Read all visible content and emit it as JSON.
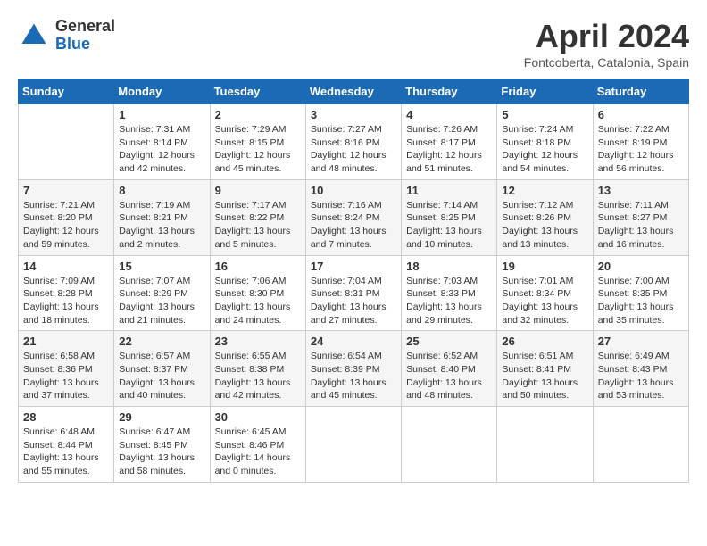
{
  "header": {
    "logo_general": "General",
    "logo_blue": "Blue",
    "month_year": "April 2024",
    "location": "Fontcoberta, Catalonia, Spain"
  },
  "weekdays": [
    "Sunday",
    "Monday",
    "Tuesday",
    "Wednesday",
    "Thursday",
    "Friday",
    "Saturday"
  ],
  "weeks": [
    [
      {
        "day": "",
        "sunrise": "",
        "sunset": "",
        "daylight": ""
      },
      {
        "day": "1",
        "sunrise": "Sunrise: 7:31 AM",
        "sunset": "Sunset: 8:14 PM",
        "daylight": "Daylight: 12 hours and 42 minutes."
      },
      {
        "day": "2",
        "sunrise": "Sunrise: 7:29 AM",
        "sunset": "Sunset: 8:15 PM",
        "daylight": "Daylight: 12 hours and 45 minutes."
      },
      {
        "day": "3",
        "sunrise": "Sunrise: 7:27 AM",
        "sunset": "Sunset: 8:16 PM",
        "daylight": "Daylight: 12 hours and 48 minutes."
      },
      {
        "day": "4",
        "sunrise": "Sunrise: 7:26 AM",
        "sunset": "Sunset: 8:17 PM",
        "daylight": "Daylight: 12 hours and 51 minutes."
      },
      {
        "day": "5",
        "sunrise": "Sunrise: 7:24 AM",
        "sunset": "Sunset: 8:18 PM",
        "daylight": "Daylight: 12 hours and 54 minutes."
      },
      {
        "day": "6",
        "sunrise": "Sunrise: 7:22 AM",
        "sunset": "Sunset: 8:19 PM",
        "daylight": "Daylight: 12 hours and 56 minutes."
      }
    ],
    [
      {
        "day": "7",
        "sunrise": "Sunrise: 7:21 AM",
        "sunset": "Sunset: 8:20 PM",
        "daylight": "Daylight: 12 hours and 59 minutes."
      },
      {
        "day": "8",
        "sunrise": "Sunrise: 7:19 AM",
        "sunset": "Sunset: 8:21 PM",
        "daylight": "Daylight: 13 hours and 2 minutes."
      },
      {
        "day": "9",
        "sunrise": "Sunrise: 7:17 AM",
        "sunset": "Sunset: 8:22 PM",
        "daylight": "Daylight: 13 hours and 5 minutes."
      },
      {
        "day": "10",
        "sunrise": "Sunrise: 7:16 AM",
        "sunset": "Sunset: 8:24 PM",
        "daylight": "Daylight: 13 hours and 7 minutes."
      },
      {
        "day": "11",
        "sunrise": "Sunrise: 7:14 AM",
        "sunset": "Sunset: 8:25 PM",
        "daylight": "Daylight: 13 hours and 10 minutes."
      },
      {
        "day": "12",
        "sunrise": "Sunrise: 7:12 AM",
        "sunset": "Sunset: 8:26 PM",
        "daylight": "Daylight: 13 hours and 13 minutes."
      },
      {
        "day": "13",
        "sunrise": "Sunrise: 7:11 AM",
        "sunset": "Sunset: 8:27 PM",
        "daylight": "Daylight: 13 hours and 16 minutes."
      }
    ],
    [
      {
        "day": "14",
        "sunrise": "Sunrise: 7:09 AM",
        "sunset": "Sunset: 8:28 PM",
        "daylight": "Daylight: 13 hours and 18 minutes."
      },
      {
        "day": "15",
        "sunrise": "Sunrise: 7:07 AM",
        "sunset": "Sunset: 8:29 PM",
        "daylight": "Daylight: 13 hours and 21 minutes."
      },
      {
        "day": "16",
        "sunrise": "Sunrise: 7:06 AM",
        "sunset": "Sunset: 8:30 PM",
        "daylight": "Daylight: 13 hours and 24 minutes."
      },
      {
        "day": "17",
        "sunrise": "Sunrise: 7:04 AM",
        "sunset": "Sunset: 8:31 PM",
        "daylight": "Daylight: 13 hours and 27 minutes."
      },
      {
        "day": "18",
        "sunrise": "Sunrise: 7:03 AM",
        "sunset": "Sunset: 8:33 PM",
        "daylight": "Daylight: 13 hours and 29 minutes."
      },
      {
        "day": "19",
        "sunrise": "Sunrise: 7:01 AM",
        "sunset": "Sunset: 8:34 PM",
        "daylight": "Daylight: 13 hours and 32 minutes."
      },
      {
        "day": "20",
        "sunrise": "Sunrise: 7:00 AM",
        "sunset": "Sunset: 8:35 PM",
        "daylight": "Daylight: 13 hours and 35 minutes."
      }
    ],
    [
      {
        "day": "21",
        "sunrise": "Sunrise: 6:58 AM",
        "sunset": "Sunset: 8:36 PM",
        "daylight": "Daylight: 13 hours and 37 minutes."
      },
      {
        "day": "22",
        "sunrise": "Sunrise: 6:57 AM",
        "sunset": "Sunset: 8:37 PM",
        "daylight": "Daylight: 13 hours and 40 minutes."
      },
      {
        "day": "23",
        "sunrise": "Sunrise: 6:55 AM",
        "sunset": "Sunset: 8:38 PM",
        "daylight": "Daylight: 13 hours and 42 minutes."
      },
      {
        "day": "24",
        "sunrise": "Sunrise: 6:54 AM",
        "sunset": "Sunset: 8:39 PM",
        "daylight": "Daylight: 13 hours and 45 minutes."
      },
      {
        "day": "25",
        "sunrise": "Sunrise: 6:52 AM",
        "sunset": "Sunset: 8:40 PM",
        "daylight": "Daylight: 13 hours and 48 minutes."
      },
      {
        "day": "26",
        "sunrise": "Sunrise: 6:51 AM",
        "sunset": "Sunset: 8:41 PM",
        "daylight": "Daylight: 13 hours and 50 minutes."
      },
      {
        "day": "27",
        "sunrise": "Sunrise: 6:49 AM",
        "sunset": "Sunset: 8:43 PM",
        "daylight": "Daylight: 13 hours and 53 minutes."
      }
    ],
    [
      {
        "day": "28",
        "sunrise": "Sunrise: 6:48 AM",
        "sunset": "Sunset: 8:44 PM",
        "daylight": "Daylight: 13 hours and 55 minutes."
      },
      {
        "day": "29",
        "sunrise": "Sunrise: 6:47 AM",
        "sunset": "Sunset: 8:45 PM",
        "daylight": "Daylight: 13 hours and 58 minutes."
      },
      {
        "day": "30",
        "sunrise": "Sunrise: 6:45 AM",
        "sunset": "Sunset: 8:46 PM",
        "daylight": "Daylight: 14 hours and 0 minutes."
      },
      {
        "day": "",
        "sunrise": "",
        "sunset": "",
        "daylight": ""
      },
      {
        "day": "",
        "sunrise": "",
        "sunset": "",
        "daylight": ""
      },
      {
        "day": "",
        "sunrise": "",
        "sunset": "",
        "daylight": ""
      },
      {
        "day": "",
        "sunrise": "",
        "sunset": "",
        "daylight": ""
      }
    ]
  ]
}
